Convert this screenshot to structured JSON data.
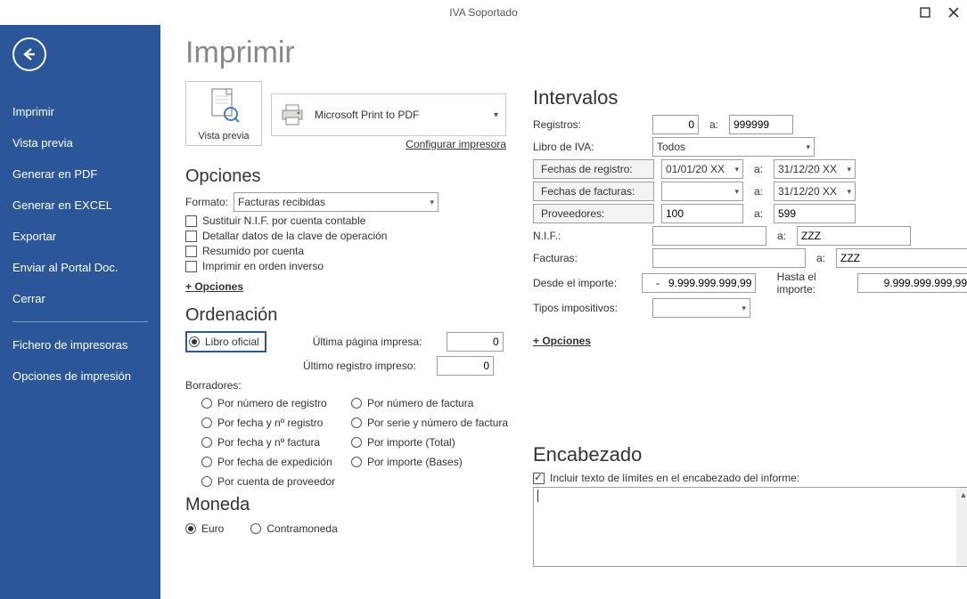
{
  "window": {
    "title": "IVA Soportado"
  },
  "sidebar": {
    "items": [
      "Imprimir",
      "Vista previa",
      "Generar en PDF",
      "Generar en EXCEL",
      "Exportar",
      "Enviar al Portal Doc.",
      "Cerrar"
    ],
    "items2": [
      "Fichero de impresoras",
      "Opciones de impresión"
    ]
  },
  "page": {
    "title": "Imprimir"
  },
  "preview_button": "Vista previa",
  "printer": {
    "name": "Microsoft Print to PDF",
    "configure": "Configurar impresora"
  },
  "opciones": {
    "title": "Opciones",
    "formato_label": "Formato:",
    "formato_value": "Facturas recibidas",
    "chk1": "Sustituir N.I.F. por cuenta contable",
    "chk2": "Detallar datos de la clave de operación",
    "chk3": "Resumido por cuenta",
    "chk4": "Imprimir en orden inverso",
    "more": "+ Opciones"
  },
  "ordenacion": {
    "title": "Ordenación",
    "libro_oficial": "Libro oficial",
    "ultima_pagina_label": "Última página impresa:",
    "ultima_pagina_value": "0",
    "ultimo_registro_label": "Último registro impreso:",
    "ultimo_registro_value": "0",
    "borradores_label": "Borradores:",
    "r1": "Por número de registro",
    "r2": "Por número de factura",
    "r3": "Por fecha y nº registro",
    "r4": "Por serie y número de factura",
    "r5": "Por fecha y nº factura",
    "r6": "Por importe (Total)",
    "r7": "Por fecha de expedición",
    "r8": "Por importe (Bases)",
    "r9": "Por cuenta de proveedor"
  },
  "moneda": {
    "title": "Moneda",
    "euro": "Euro",
    "contra": "Contramoneda"
  },
  "intervalos": {
    "title": "Intervalos",
    "registros_label": "Registros:",
    "reg_from": "0",
    "a": "a:",
    "reg_to": "999999",
    "libro_iva_label": "Libro de IVA:",
    "libro_iva_value": "Todos",
    "fechas_registro_label": "Fechas de registro:",
    "fr_from": "01/01/20 XX",
    "fr_to": "31/12/20 XX",
    "fechas_facturas_label": "Fechas de facturas:",
    "ff_from": "",
    "ff_to": "31/12/20 XX",
    "proveedores_label": "Proveedores:",
    "prov_from": "100",
    "prov_to": "599",
    "nif_label": "N.I.F.:",
    "nif_from": "",
    "nif_to": "ZZZ",
    "facturas_label": "Facturas:",
    "fact_from": "",
    "fact_to": "ZZZ",
    "desde_importe_label": "Desde el importe:",
    "desde_importe_value": "-   9.999.999.999,99",
    "hasta_importe_label": "Hasta el importe:",
    "hasta_importe_value": "9.999.999.999,99",
    "tipos_label": "Tipos impositivos:",
    "tipos_value": "",
    "more": "+ Opciones"
  },
  "encabezado": {
    "title": "Encabezado",
    "chk": "Incluir texto de límites en el encabezado del informe:"
  }
}
